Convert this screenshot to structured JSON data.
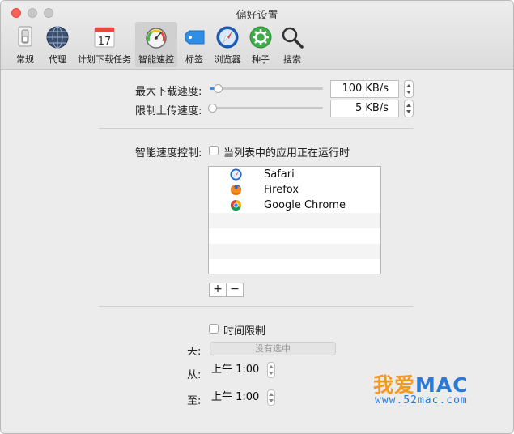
{
  "window": {
    "title": "偏好设置"
  },
  "toolbar": {
    "tabs": [
      {
        "label": "常规",
        "icon": "switch-icon"
      },
      {
        "label": "代理",
        "icon": "globe-icon"
      },
      {
        "label": "计划下载任务",
        "icon": "calendar-icon",
        "icon_text": "17"
      },
      {
        "label": "智能速控",
        "icon": "speedometer-icon",
        "active": true
      },
      {
        "label": "标签",
        "icon": "tag-icon"
      },
      {
        "label": "浏览器",
        "icon": "compass-icon"
      },
      {
        "label": "种子",
        "icon": "gear-icon"
      },
      {
        "label": "搜索",
        "icon": "magnifier-icon"
      }
    ]
  },
  "speed": {
    "download_label": "最大下载速度:",
    "download_value": "100 KB/s",
    "download_level": 0.05,
    "upload_label": "限制上传速度:",
    "upload_value": "5 KB/s",
    "upload_level": 0.0
  },
  "smart": {
    "label": "智能速度控制:",
    "checkbox_label": "当列表中的应用正在运行时",
    "checked": false,
    "apps": [
      {
        "name": "Safari",
        "icon": "safari-icon"
      },
      {
        "name": "Firefox",
        "icon": "firefox-icon"
      },
      {
        "name": "Google Chrome",
        "icon": "chrome-icon"
      }
    ],
    "add_label": "+",
    "remove_label": "−"
  },
  "schedule": {
    "checkbox_label": "时间限制",
    "checked": false,
    "day_label": "天:",
    "day_value": "没有选中",
    "from_label": "从:",
    "from_value": "上午  1:00",
    "to_label": "至:",
    "to_value": "上午  1:00"
  },
  "watermark": {
    "title": "我爱MAC",
    "url": "www.52mac.com",
    "color_orange": "#f39a1e",
    "color_blue": "#2a7ad8"
  },
  "colors": {
    "accent": "#3b8cf5",
    "close": "#fc5f57"
  }
}
